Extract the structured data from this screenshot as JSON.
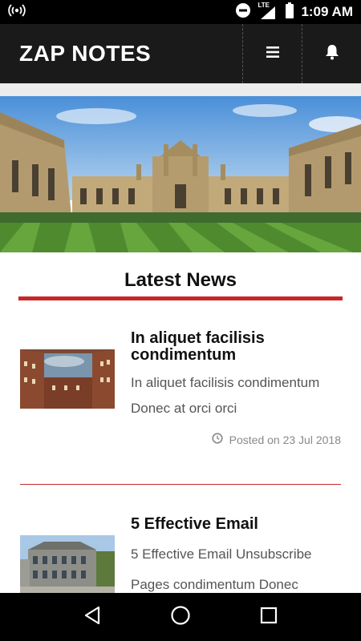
{
  "status_bar": {
    "time": "1:09 AM",
    "network": "LTE",
    "icons": [
      "hotspot-icon",
      "do-not-disturb-icon",
      "signal-icon",
      "battery-icon"
    ]
  },
  "app_bar": {
    "title": "ZAP NOTES",
    "menu_icon": "hamburger-menu-icon",
    "notification_icon": "bell-icon"
  },
  "section": {
    "title": "Latest News"
  },
  "news": [
    {
      "title": "In aliquet facilisis condimentum",
      "excerpt_line1": "In aliquet facilisis condimentum",
      "excerpt_line2": "Donec at orci orci",
      "date": "Posted on 23 Jul 2018"
    },
    {
      "title": "5 Effective Email",
      "excerpt_line1": "5 Effective Email Unsubscribe",
      "excerpt_line2": "Pages condimentum Donec"
    }
  ],
  "nav_bar": {
    "icons": [
      "back-icon",
      "home-icon",
      "recents-icon"
    ]
  },
  "colors": {
    "accent": "#c62828",
    "app_bar": "#1a1a1a"
  }
}
